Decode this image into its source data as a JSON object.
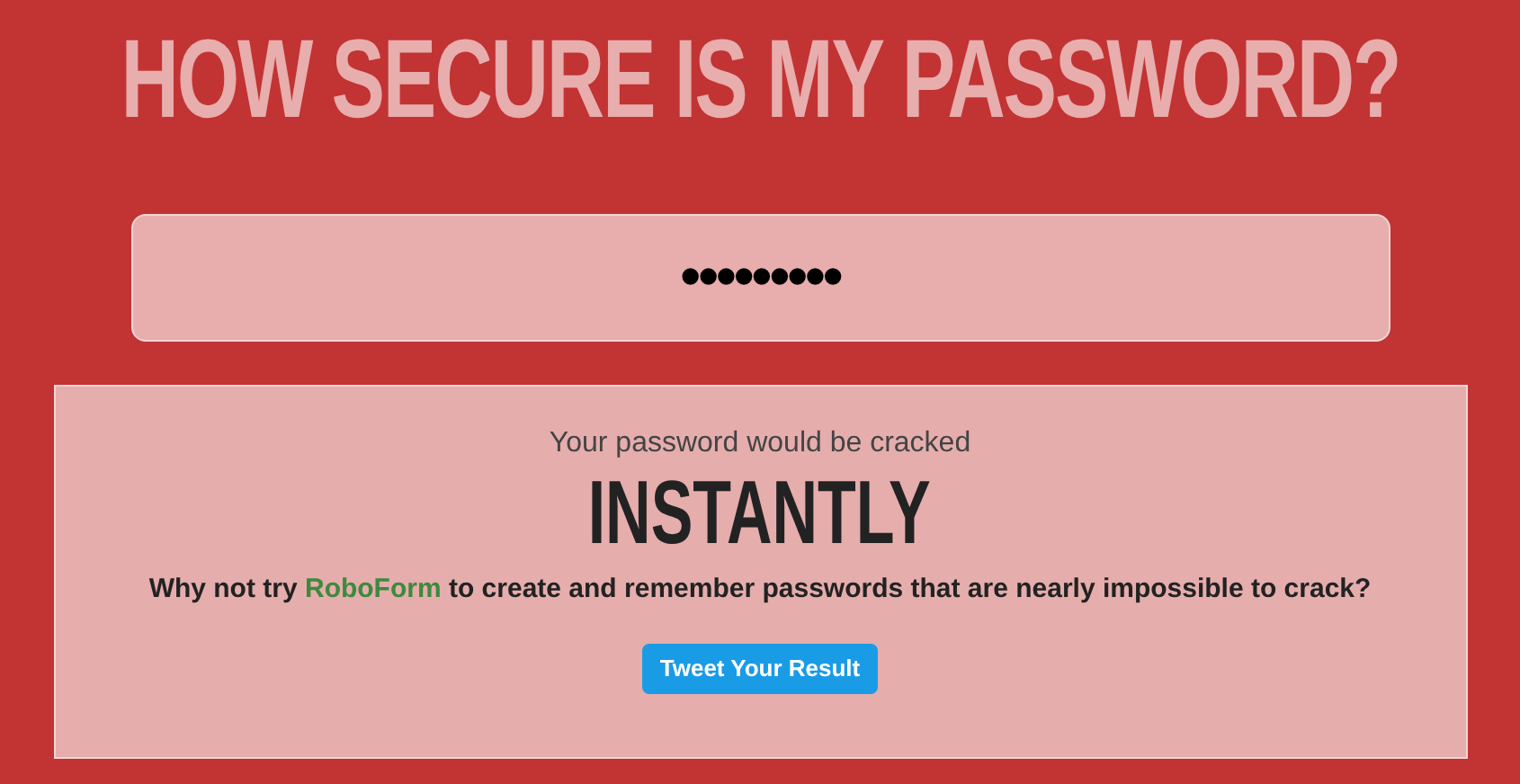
{
  "title": "HOW SECURE IS MY PASSWORD?",
  "password_field": {
    "value": "•••••••••"
  },
  "result": {
    "intro": "Your password would be cracked",
    "time": "INSTANTLY",
    "message_before": "Why not try",
    "link": "RoboForm",
    "message_after": "to create and remember passwords that are nearly impossible to crack?",
    "button": "Tweet Your Result"
  }
}
